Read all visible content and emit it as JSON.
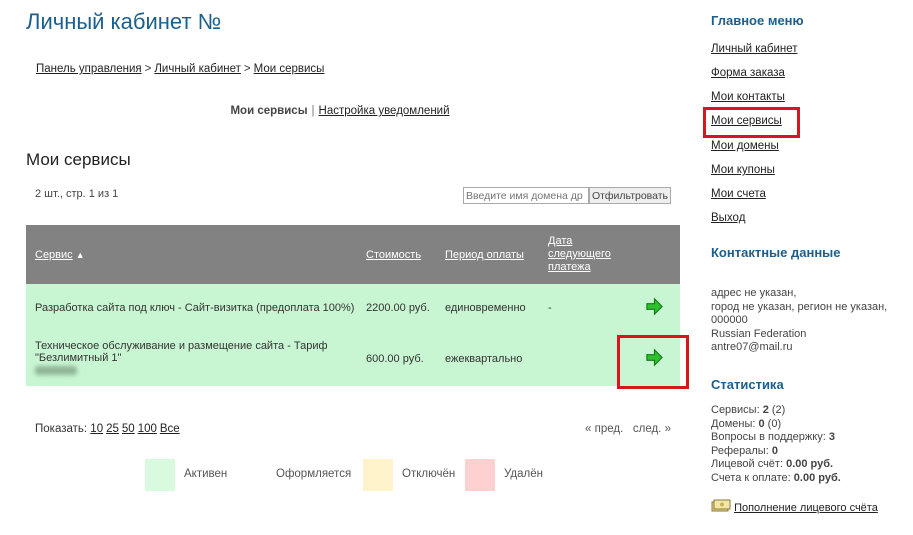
{
  "page_title": "Личный кабинет №",
  "breadcrumb": [
    "Панель управления",
    "Личный кабинет",
    "Мои сервисы"
  ],
  "subtabs": {
    "current": "Мои сервисы",
    "other": "Настройка уведомлений"
  },
  "section_title": "Мои сервисы",
  "count_text": "2 шт., стр. 1 из 1",
  "filter": {
    "placeholder": "Введите имя домена др",
    "button": "Отфильтровать"
  },
  "table": {
    "headers": {
      "service": "Сервис",
      "sort_indicator": "▲",
      "cost": "Стоимость",
      "period": "Период оплаты",
      "next_payment": "Дата следующего платежа"
    },
    "rows": [
      {
        "service": "Разработка сайта под ключ - Сайт-визитка (предоплата 100%)",
        "cost": "2200.00 руб.",
        "period": "единовременно",
        "next_payment": "-"
      },
      {
        "service": "Техническое обслуживание и размещение сайта - Тариф \"Безлимитный 1\"",
        "cost": "600.00 руб.",
        "period": "ежеквартально",
        "next_payment": ""
      }
    ]
  },
  "pager": {
    "label": "Показать:",
    "sizes": [
      "10",
      "25",
      "50",
      "100",
      "Все"
    ],
    "prev": "« пред.",
    "next": "след. »"
  },
  "legend": [
    {
      "label": "Активен",
      "color": "#d8fbe0"
    },
    {
      "label": "Оформляется",
      "color": "#ffffff"
    },
    {
      "label": "Отключён",
      "color": "#fff3cc"
    },
    {
      "label": "Удалён",
      "color": "#ffd0d0"
    }
  ],
  "sidebar": {
    "menu_title": "Главное меню",
    "menu": [
      "Личный кабинет",
      "Форма заказа",
      "Мои контакты",
      "Мои сервисы",
      "Мои домены",
      "Мои купоны",
      "Мои счета",
      "Выход"
    ],
    "contacts_title": "Контактные данные",
    "contacts": [
      "адрес не указан,",
      "город не указан, регион не указан,",
      "000000",
      "Russian Federation",
      "antre07@mail.ru"
    ],
    "stats_title": "Статистика",
    "stats": [
      {
        "label": "Сервисы:",
        "value": "2",
        "extra": "(2)"
      },
      {
        "label": "Домены:",
        "value": "0",
        "extra": "(0)"
      },
      {
        "label": "Вопросы в поддержку:",
        "value": "3",
        "extra": ""
      },
      {
        "label": "Рефералы:",
        "value": "0",
        "extra": ""
      },
      {
        "label": "Лицевой счёт:",
        "value": "0.00 руб.",
        "extra": ""
      },
      {
        "label": "Счета к оплате:",
        "value": "0.00 руб.",
        "extra": ""
      }
    ],
    "topup": "Пополнение лицевого счёта"
  },
  "colors": {
    "accent": "#1b5f8e",
    "table_header": "#828282",
    "row_active": "#c8f5d2",
    "highlight": "#d7171d",
    "arrow": "#2fbf2f"
  }
}
